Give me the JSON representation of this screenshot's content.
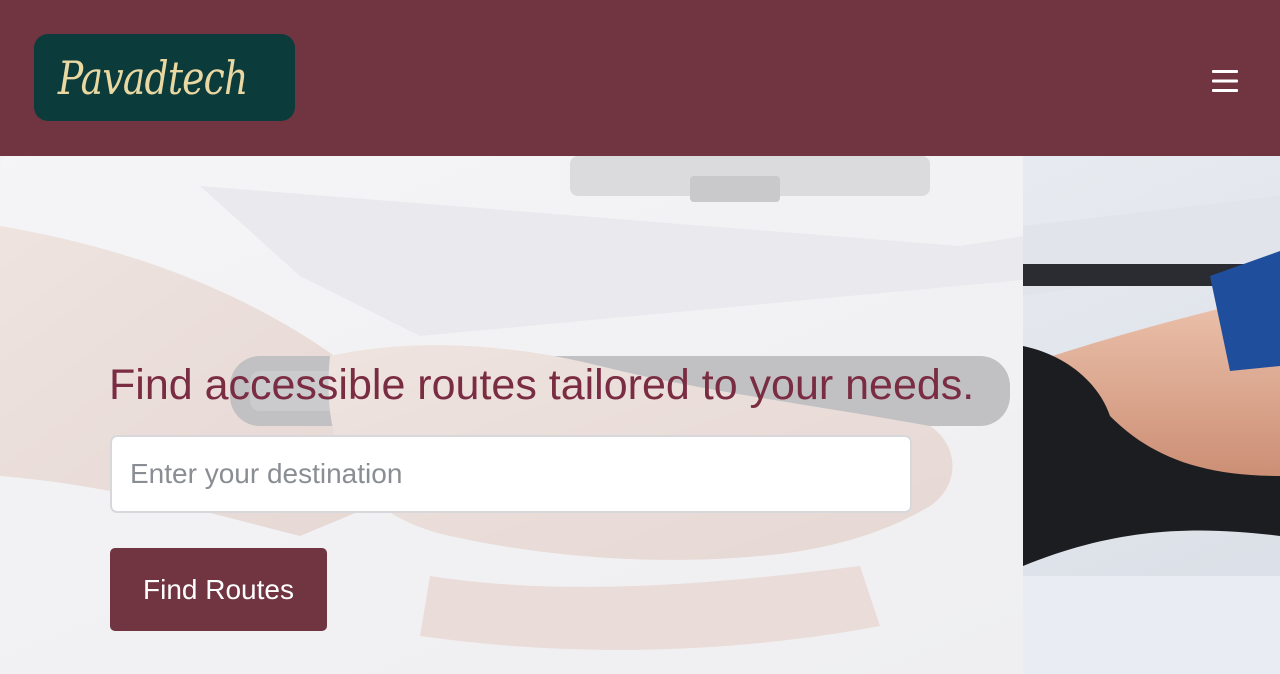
{
  "header": {
    "logo_text": "Pavadtech",
    "menu_icon": "hamburger-menu-icon"
  },
  "hero": {
    "title": "Find accessible routes tailored to your needs.",
    "search": {
      "placeholder": "Enter your destination",
      "value": ""
    },
    "button_label": "Find Routes",
    "image_subject": "hand-on-wheelchair-wheel-photo"
  },
  "colors": {
    "brand": "#713441",
    "logo_background": "#0c3b3b",
    "logo_text": "#e9d8a2",
    "title_text": "#7a2c42"
  }
}
